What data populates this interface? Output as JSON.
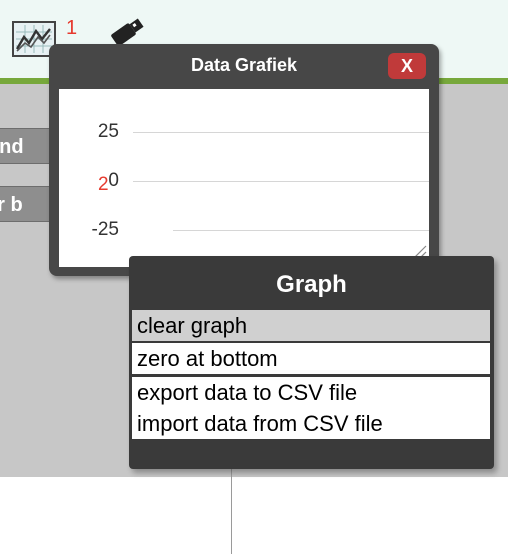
{
  "toolbar": {
    "graph_badge": "1"
  },
  "side_buttons": [
    {
      "label": "and"
    },
    {
      "label": "er b"
    }
  ],
  "data_window": {
    "title": "Data Grafiek",
    "close_label": "X",
    "y_ticks": [
      "25",
      "0",
      "-25"
    ],
    "series_badge": "2"
  },
  "context_menu": {
    "header": "Graph",
    "items": [
      {
        "label": "clear graph",
        "highlighted": true
      },
      {
        "label": "zero at bottom"
      },
      {
        "label": "export data to CSV file"
      },
      {
        "label": "import data from CSV file"
      }
    ]
  },
  "colors": {
    "accent_green": "#77a83b",
    "badge_red": "#e63a2e",
    "close_red": "#c03a3a"
  }
}
